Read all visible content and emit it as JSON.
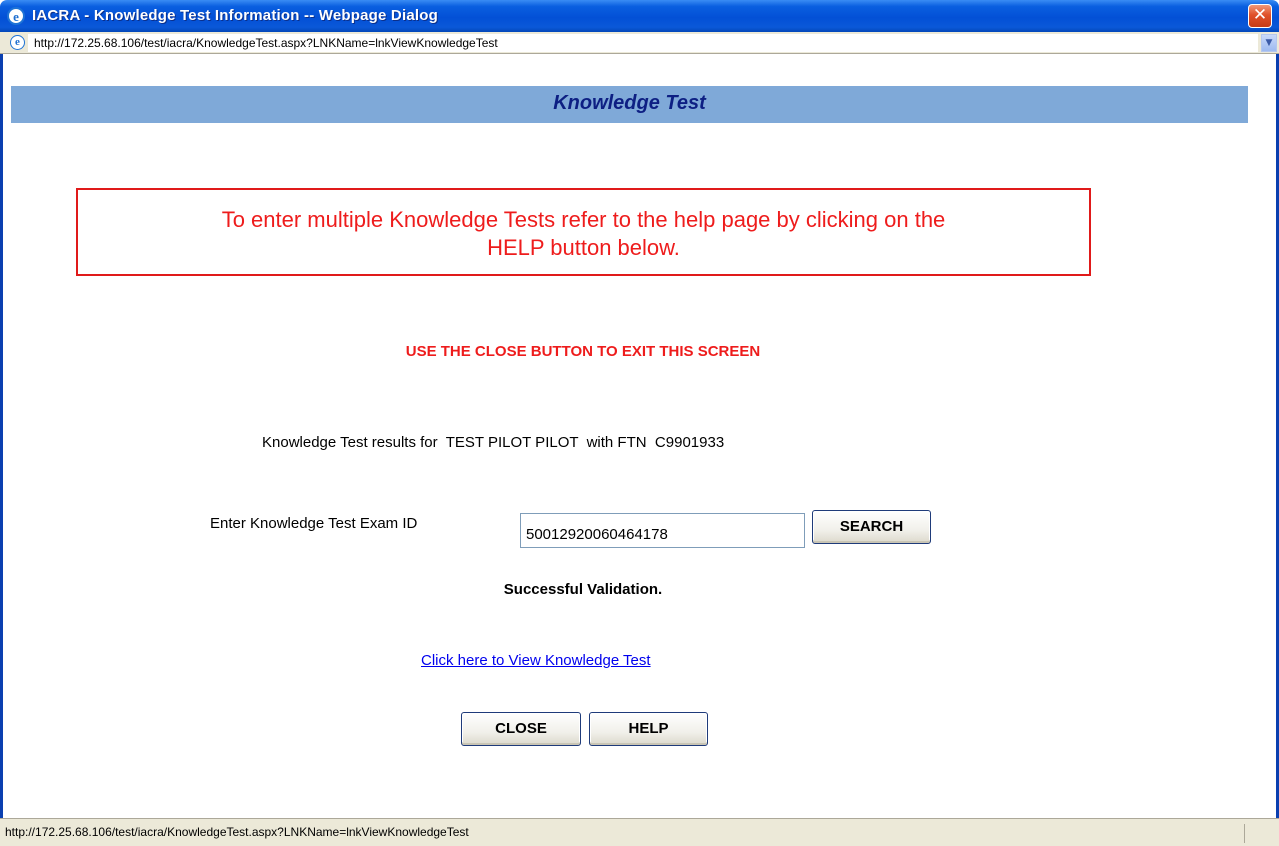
{
  "window": {
    "title": "IACRA - Knowledge Test Information -- Webpage Dialog",
    "close_glyph": "✕"
  },
  "address_bar": {
    "url": "http://172.25.68.106/test/iacra/KnowledgeTest.aspx?LNKName=lnkViewKnowledgeTest",
    "dropdown_glyph": "▼"
  },
  "header": {
    "title": "Knowledge Test",
    "background_color": "#7fa9d8",
    "title_color": "#0d1f83"
  },
  "notice": {
    "line1": "To enter multiple Knowledge Tests refer to the help page by clicking on the",
    "line2": "HELP button below.",
    "color": "#ee1c1c"
  },
  "exit_message": "USE THE CLOSE BUTTON TO EXIT THIS SCREEN",
  "results": {
    "text": "Knowledge Test results for  TEST PILOT PILOT  with FTN  C9901933"
  },
  "exam_search": {
    "label": "Enter Knowledge Test Exam ID",
    "value": "50012920060464178",
    "search_label": "SEARCH"
  },
  "success_message": "Successful Validation.",
  "view_link": "Click here to View Knowledge Test",
  "buttons": {
    "close_label": "CLOSE",
    "help_label": "HELP"
  },
  "status_bar": {
    "text": "http://172.25.68.106/test/iacra/KnowledgeTest.aspx?LNKName=lnkViewKnowledgeTest"
  },
  "icons": {
    "window_icon": "ie-icon",
    "address_icon": "ie-page-icon",
    "glyph": "e"
  }
}
